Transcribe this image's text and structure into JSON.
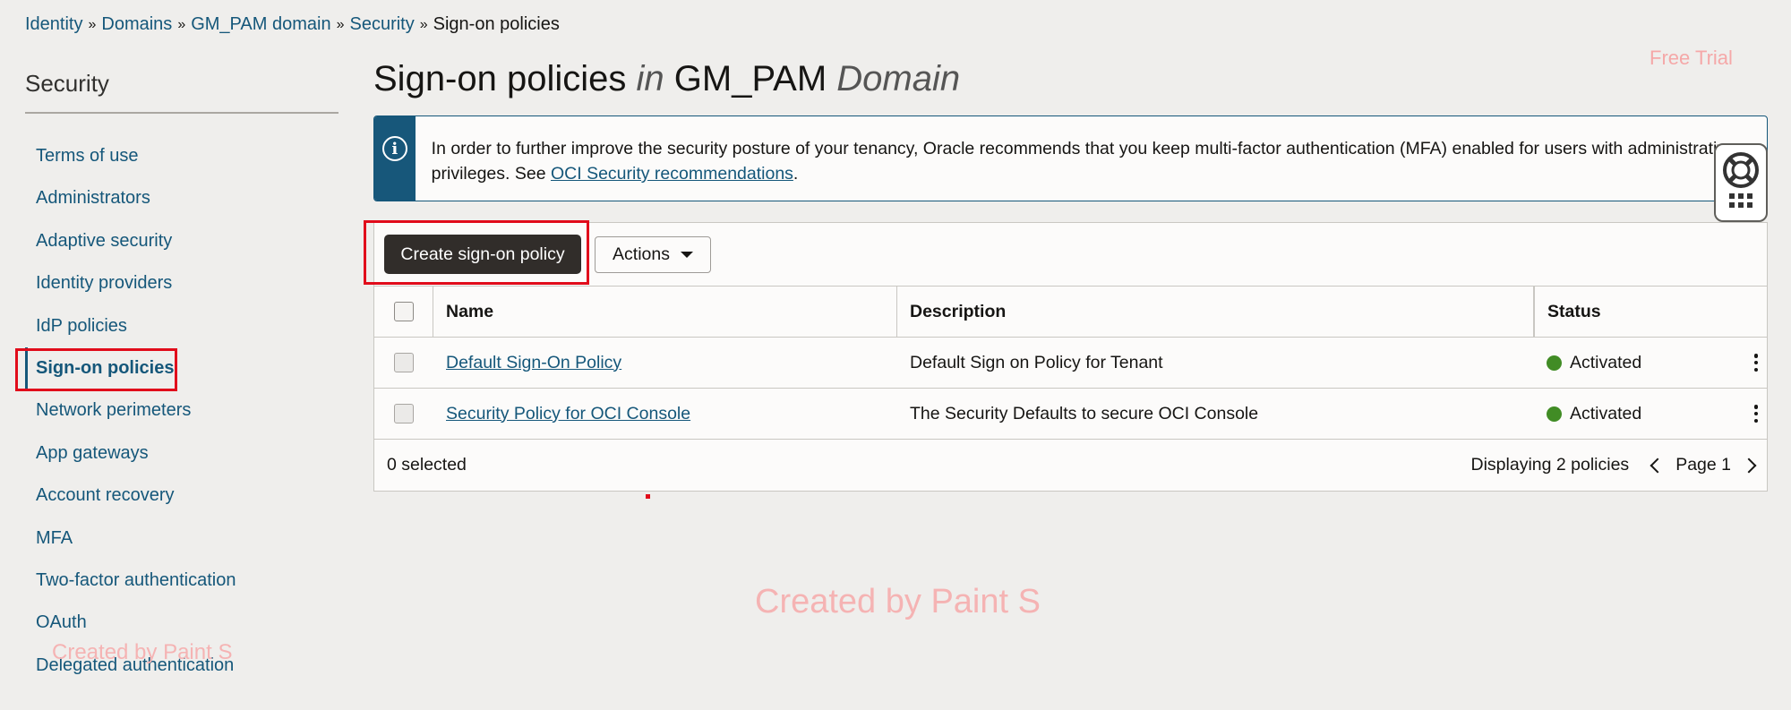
{
  "breadcrumb": {
    "items": [
      "Identity",
      "Domains",
      "GM_PAM domain",
      "Security"
    ],
    "current": "Sign-on policies",
    "separator": "»"
  },
  "sidebar": {
    "title": "Security",
    "items": [
      {
        "label": "Terms of use"
      },
      {
        "label": "Administrators"
      },
      {
        "label": "Adaptive security"
      },
      {
        "label": "Identity providers"
      },
      {
        "label": "IdP policies"
      },
      {
        "label": "Sign-on policies",
        "active": true
      },
      {
        "label": "Network perimeters"
      },
      {
        "label": "App gateways"
      },
      {
        "label": "Account recovery"
      },
      {
        "label": "MFA"
      },
      {
        "label": "Two-factor authentication"
      },
      {
        "label": "OAuth"
      },
      {
        "label": "Delegated authentication"
      }
    ]
  },
  "page": {
    "title_main": "Sign-on policies",
    "title_in": "in",
    "title_domain": "GM_PAM",
    "title_domain_word": "Domain"
  },
  "free_trial": "Free Trial",
  "banner": {
    "icon": "info-icon",
    "text": "In order to further improve the security posture of your tenancy, Oracle recommends that you keep multi-factor authentication (MFA) enabled for users with administrative privileges. See ",
    "link_text": "OCI Security recommendations",
    "text_end": "."
  },
  "help_widget": {
    "icons": [
      "lifebuoy-icon",
      "apps-grid-icon"
    ]
  },
  "toolbar": {
    "create_label": "Create sign-on policy",
    "actions_label": "Actions"
  },
  "table": {
    "columns": [
      "Name",
      "Description",
      "Status"
    ],
    "rows": [
      {
        "name": "Default Sign-On Policy",
        "description": "Default Sign on Policy for Tenant",
        "status": "Activated"
      },
      {
        "name": "Security Policy for OCI Console",
        "description": "The Security Defaults to secure OCI Console",
        "status": "Activated"
      }
    ],
    "selected_text": "0 selected",
    "displaying_text": "Displaying 2 policies",
    "page_text": "Page 1"
  },
  "watermark": "Created by Paint S",
  "colors": {
    "link": "#15577a",
    "primary_button": "#312d2a",
    "status_active": "#418c25",
    "highlight": "#e10c1b"
  }
}
